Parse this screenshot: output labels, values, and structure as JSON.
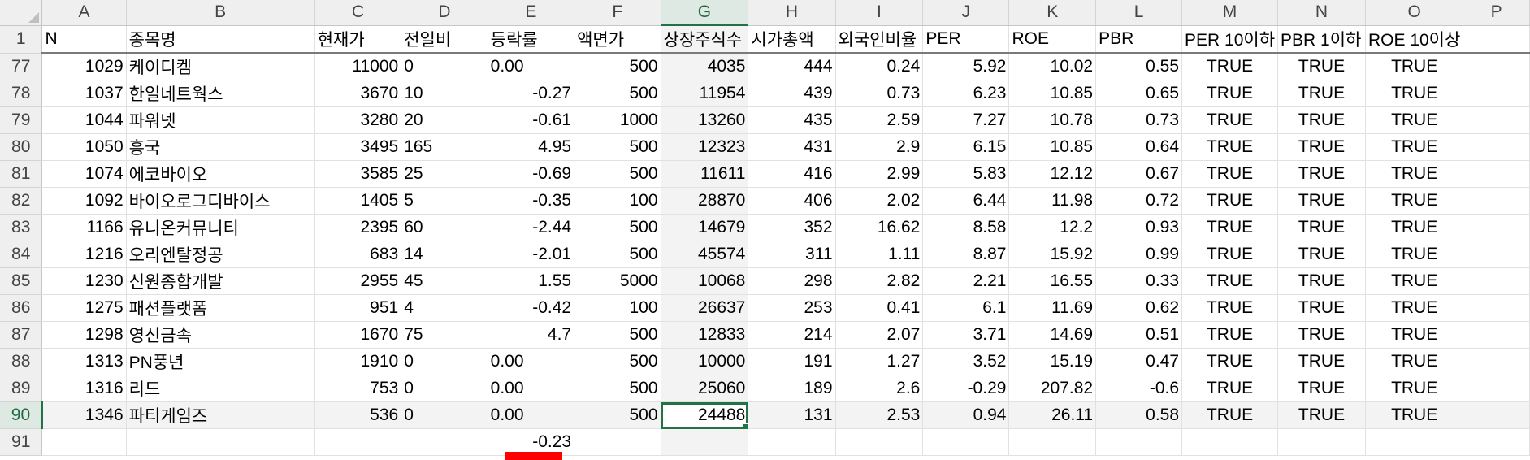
{
  "columns": [
    "A",
    "B",
    "C",
    "D",
    "E",
    "F",
    "G",
    "H",
    "I",
    "J",
    "K",
    "L",
    "M",
    "N",
    "O",
    "P"
  ],
  "selected_column": "G",
  "selected_row": "90",
  "header_row": {
    "row_number": "1",
    "cells": [
      "N",
      "종목명",
      "현재가",
      "전일비",
      "등락률",
      "액면가",
      "상장주식수",
      "시가총액",
      "외국인비율",
      "PER",
      "ROE",
      "PBR",
      "PER 10이하",
      "PBR 1이하",
      "ROE 10이상",
      ""
    ]
  },
  "rows": [
    {
      "row_number": "77",
      "cells": [
        "1029",
        "케이디켐",
        "11000",
        "0",
        "0.00",
        "500",
        "4035",
        "444",
        "0.24",
        "5.92",
        "10.02",
        "0.55",
        "TRUE",
        "TRUE",
        "TRUE",
        ""
      ]
    },
    {
      "row_number": "78",
      "cells": [
        "1037",
        "한일네트웍스",
        "3670",
        "10",
        "-0.27",
        "500",
        "11954",
        "439",
        "0.73",
        "6.23",
        "10.85",
        "0.65",
        "TRUE",
        "TRUE",
        "TRUE",
        ""
      ]
    },
    {
      "row_number": "79",
      "cells": [
        "1044",
        "파워넷",
        "3280",
        "20",
        "-0.61",
        "1000",
        "13260",
        "435",
        "2.59",
        "7.27",
        "10.78",
        "0.73",
        "TRUE",
        "TRUE",
        "TRUE",
        ""
      ]
    },
    {
      "row_number": "80",
      "cells": [
        "1050",
        "흥국",
        "3495",
        "165",
        "4.95",
        "500",
        "12323",
        "431",
        "2.9",
        "6.15",
        "10.85",
        "0.64",
        "TRUE",
        "TRUE",
        "TRUE",
        ""
      ]
    },
    {
      "row_number": "81",
      "cells": [
        "1074",
        "에코바이오",
        "3585",
        "25",
        "-0.69",
        "500",
        "11611",
        "416",
        "2.99",
        "5.83",
        "12.12",
        "0.67",
        "TRUE",
        "TRUE",
        "TRUE",
        ""
      ]
    },
    {
      "row_number": "82",
      "cells": [
        "1092",
        "바이오로그디바이스",
        "1405",
        "5",
        "-0.35",
        "100",
        "28870",
        "406",
        "2.02",
        "6.44",
        "11.98",
        "0.72",
        "TRUE",
        "TRUE",
        "TRUE",
        ""
      ]
    },
    {
      "row_number": "83",
      "cells": [
        "1166",
        "유니온커뮤니티",
        "2395",
        "60",
        "-2.44",
        "500",
        "14679",
        "352",
        "16.62",
        "8.58",
        "12.2",
        "0.93",
        "TRUE",
        "TRUE",
        "TRUE",
        ""
      ]
    },
    {
      "row_number": "84",
      "cells": [
        "1216",
        "오리엔탈정공",
        "683",
        "14",
        "-2.01",
        "500",
        "45574",
        "311",
        "1.11",
        "8.87",
        "15.92",
        "0.99",
        "TRUE",
        "TRUE",
        "TRUE",
        ""
      ]
    },
    {
      "row_number": "85",
      "cells": [
        "1230",
        "신원종합개발",
        "2955",
        "45",
        "1.55",
        "5000",
        "10068",
        "298",
        "2.82",
        "2.21",
        "16.55",
        "0.33",
        "TRUE",
        "TRUE",
        "TRUE",
        ""
      ]
    },
    {
      "row_number": "86",
      "cells": [
        "1275",
        "패션플랫폼",
        "951",
        "4",
        "-0.42",
        "100",
        "26637",
        "253",
        "0.41",
        "6.1",
        "11.69",
        "0.62",
        "TRUE",
        "TRUE",
        "TRUE",
        ""
      ]
    },
    {
      "row_number": "87",
      "cells": [
        "1298",
        "영신금속",
        "1670",
        "75",
        "4.7",
        "500",
        "12833",
        "214",
        "2.07",
        "3.71",
        "14.69",
        "0.51",
        "TRUE",
        "TRUE",
        "TRUE",
        ""
      ]
    },
    {
      "row_number": "88",
      "cells": [
        "1313",
        "PN풍년",
        "1910",
        "0",
        "0.00",
        "500",
        "10000",
        "191",
        "1.27",
        "3.52",
        "15.19",
        "0.47",
        "TRUE",
        "TRUE",
        "TRUE",
        ""
      ]
    },
    {
      "row_number": "89",
      "cells": [
        "1316",
        "리드",
        "753",
        "0",
        "0.00",
        "500",
        "25060",
        "189",
        "2.6",
        "-0.29",
        "207.82",
        "-0.6",
        "TRUE",
        "TRUE",
        "TRUE",
        ""
      ]
    },
    {
      "row_number": "90",
      "cells": [
        "1346",
        "파티게임즈",
        "536",
        "0",
        "0.00",
        "500",
        "24488",
        "131",
        "2.53",
        "0.94",
        "26.11",
        "0.58",
        "TRUE",
        "TRUE",
        "TRUE",
        ""
      ]
    },
    {
      "row_number": "91",
      "cells": [
        "",
        "",
        "",
        "",
        "-0.23",
        "",
        "",
        "",
        "",
        "",
        "",
        "",
        "",
        "",
        "",
        ""
      ]
    }
  ],
  "colors": {
    "selection_green": "#217346",
    "marker_red": "#ff0000",
    "header_bg": "#efefef"
  }
}
